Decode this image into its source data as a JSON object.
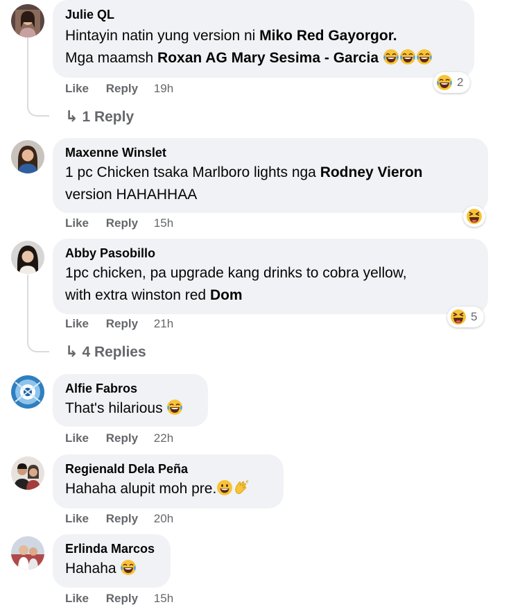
{
  "colors": {
    "bubble": "#f0f2f5",
    "meta_text": "#65676b",
    "thread_line": "#d9dadd",
    "emoji_face": "#f7c337",
    "emoji_mouth": "#5b2a16"
  },
  "comments": [
    {
      "author": "Julie QL",
      "line1_pre": "Hintayin natin yung version ni ",
      "line1_bold": "Miko Red Gayorgor.",
      "line2_pre": "Mga maamsh ",
      "line2_bold": "Roxan AG Mary Sesima - Garcia",
      "inline_emojis": [
        "laughing-crying-emoji",
        "laughing-crying-emoji",
        "laughing-crying-emoji"
      ],
      "like": "Like",
      "reply": "Reply",
      "time": "19h",
      "reaction_icon": "laughing-crying-emoji",
      "reaction_count": "2",
      "replies": "1 Reply"
    },
    {
      "author": "Maxenne Winslet",
      "line1_pre": "1 pc Chicken tsaka Marlboro lights nga ",
      "line1_bold": "Rodney Vieron",
      "line2_pre": "version HAHAHHAA",
      "like": "Like",
      "reply": "Reply",
      "time": "15h",
      "reaction_icon": "laughing-squint-emoji"
    },
    {
      "author": "Abby Pasobillo",
      "line1_pre": "1pc chicken, pa upgrade kang drinks to cobra yellow,",
      "line2_pre": "with extra winston red ",
      "line2_bold": "Dom",
      "like": "Like",
      "reply": "Reply",
      "time": "21h",
      "reaction_icon": "laughing-squint-emoji",
      "reaction_count": "5",
      "replies": "4 Replies"
    },
    {
      "author": "Alfie Fabros",
      "text": "That's hilarious",
      "inline_emojis": [
        "laughing-crying-emoji"
      ],
      "like": "Like",
      "reply": "Reply",
      "time": "22h"
    },
    {
      "author": "Regienald Dela Peña",
      "text": "Hahaha alupit moh pre.",
      "inline_emojis": [
        "grinning-emoji",
        "clapping-hands-emoji"
      ],
      "like": "Like",
      "reply": "Reply",
      "time": "20h"
    },
    {
      "author": "Erlinda Marcos",
      "text": "Hahaha",
      "inline_emojis": [
        "laughing-crying-emoji"
      ],
      "like": "Like",
      "reply": "Reply",
      "time": "15h"
    }
  ]
}
